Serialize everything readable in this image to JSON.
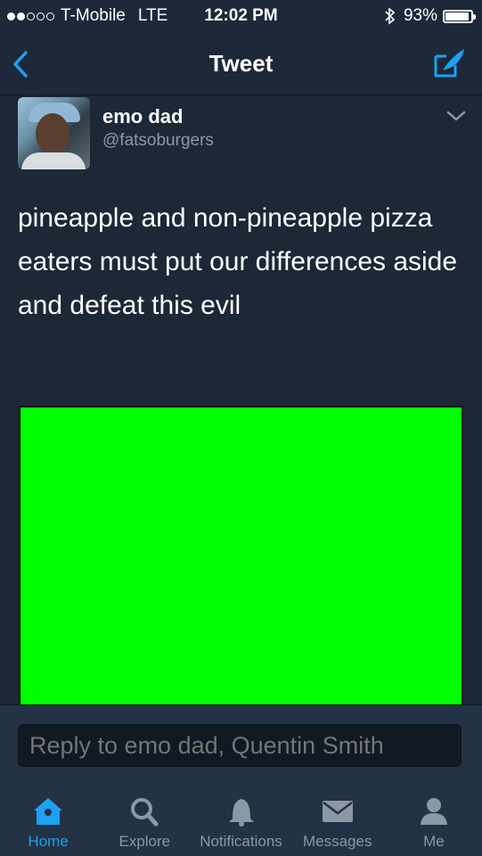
{
  "status_bar": {
    "carrier": "T-Mobile",
    "network": "LTE",
    "time": "12:02 PM",
    "battery_text": "93%",
    "battery_level": 0.93,
    "signal_bars_filled": 2,
    "signal_bars_total": 5
  },
  "nav": {
    "title": "Tweet",
    "back_icon": "chevron-left-icon",
    "compose_icon": "compose-tweet-icon"
  },
  "tweet": {
    "user_name": "emo dad",
    "user_handle": "@fatsoburgers",
    "text": "pineapple and non-pineapple pizza eaters must put our differences aside and defeat this evil",
    "media_color": "#00ff00"
  },
  "reply": {
    "placeholder": "Reply to emo dad, Quentin Smith"
  },
  "tabs": [
    {
      "label": "Home",
      "icon": "home-icon",
      "active": true
    },
    {
      "label": "Explore",
      "icon": "search-icon",
      "active": false
    },
    {
      "label": "Notifications",
      "icon": "bell-icon",
      "active": false
    },
    {
      "label": "Messages",
      "icon": "envelope-icon",
      "active": false
    },
    {
      "label": "Me",
      "icon": "person-icon",
      "active": false
    }
  ],
  "colors": {
    "background": "#1c2836",
    "accent": "#1da1f2",
    "secondary_text": "#8b98a6"
  }
}
